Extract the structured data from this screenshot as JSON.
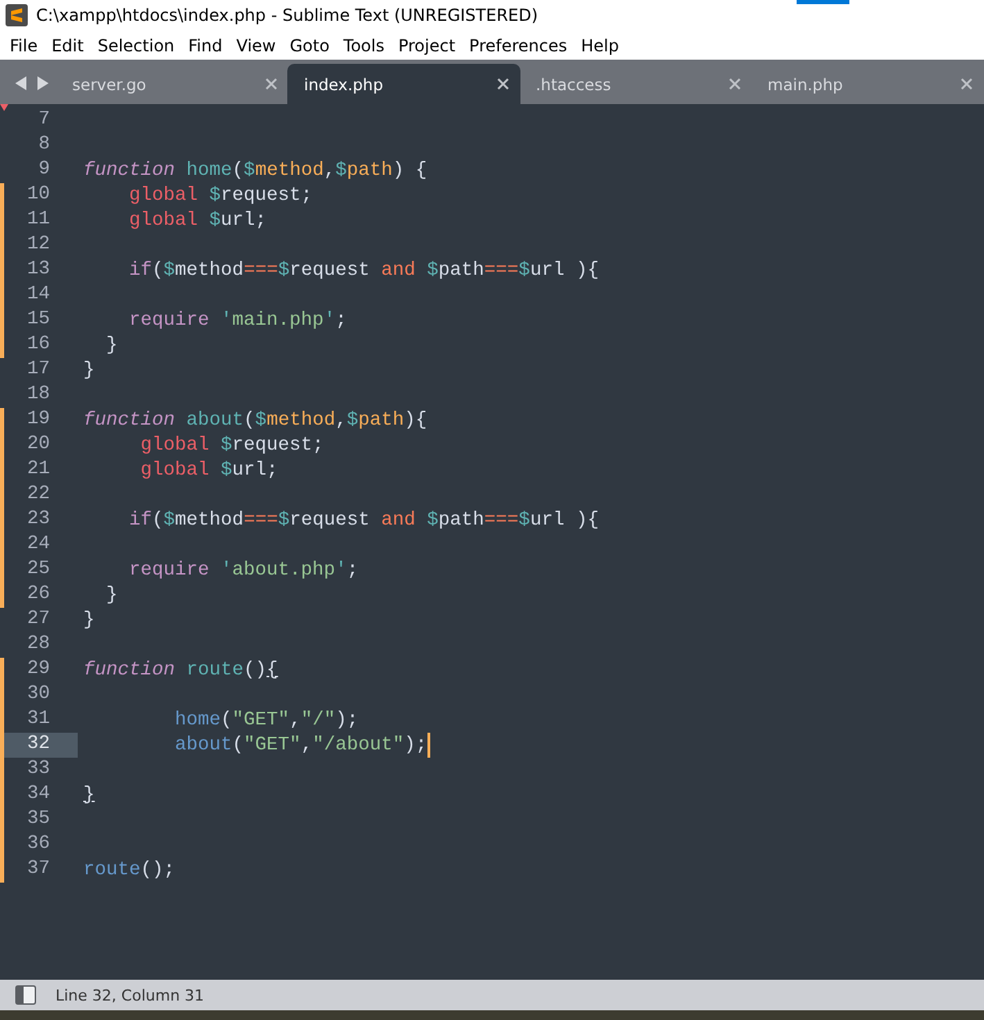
{
  "window": {
    "title": "C:\\xampp\\htdocs\\index.php - Sublime Text (UNREGISTERED)"
  },
  "menu": [
    {
      "label": "File"
    },
    {
      "label": "Edit"
    },
    {
      "label": "Selection"
    },
    {
      "label": "Find"
    },
    {
      "label": "View"
    },
    {
      "label": "Goto"
    },
    {
      "label": "Tools"
    },
    {
      "label": "Project"
    },
    {
      "label": "Preferences"
    },
    {
      "label": "Help"
    }
  ],
  "tabs": [
    {
      "label": "server.go",
      "selected": false
    },
    {
      "label": "index.php",
      "selected": true
    },
    {
      "label": ".htaccess",
      "selected": false
    },
    {
      "label": "main.php",
      "selected": false
    }
  ],
  "lines": [
    {
      "number": "7",
      "modified": false,
      "current": false
    },
    {
      "number": "8",
      "modified": false,
      "current": false
    },
    {
      "number": "9",
      "modified": false,
      "current": false,
      "tokens": [
        {
          "t": "function ",
          "kind": "kw"
        },
        {
          "t": "home",
          "kind": "fn"
        },
        {
          "t": "(",
          "kind": "plain"
        },
        {
          "t": "$",
          "kind": "dollar"
        },
        {
          "t": "method",
          "kind": "param"
        },
        {
          "t": ",",
          "kind": "plain"
        },
        {
          "t": "$",
          "kind": "dollar"
        },
        {
          "t": "path",
          "kind": "param"
        },
        {
          "t": ") {",
          "kind": "plain"
        }
      ]
    },
    {
      "number": "10",
      "modified": true,
      "current": false,
      "tokens": [
        {
          "t": "    global ",
          "kind": "global"
        },
        {
          "t": "$",
          "kind": "dollar"
        },
        {
          "t": "request;",
          "kind": "plain"
        }
      ]
    },
    {
      "number": "11",
      "modified": true,
      "current": false,
      "tokens": [
        {
          "t": "    global ",
          "kind": "global"
        },
        {
          "t": "$",
          "kind": "dollar"
        },
        {
          "t": "url;",
          "kind": "plain"
        }
      ]
    },
    {
      "number": "12",
      "modified": true,
      "current": false
    },
    {
      "number": "13",
      "modified": true,
      "current": false,
      "tokens": [
        {
          "t": "    if",
          "kind": "kw2"
        },
        {
          "t": "(",
          "kind": "plain"
        },
        {
          "t": "$",
          "kind": "dollar"
        },
        {
          "t": "method",
          "kind": "plain"
        },
        {
          "t": "===",
          "kind": "op"
        },
        {
          "t": "$",
          "kind": "dollar"
        },
        {
          "t": "request ",
          "kind": "plain"
        },
        {
          "t": "and ",
          "kind": "op"
        },
        {
          "t": "$",
          "kind": "dollar"
        },
        {
          "t": "path",
          "kind": "plain"
        },
        {
          "t": "===",
          "kind": "op"
        },
        {
          "t": "$",
          "kind": "dollar"
        },
        {
          "t": "url ){",
          "kind": "plain"
        }
      ]
    },
    {
      "number": "14",
      "modified": true,
      "current": false
    },
    {
      "number": "15",
      "modified": true,
      "current": false,
      "tokens": [
        {
          "t": "    require ",
          "kind": "kw2"
        },
        {
          "t": "'",
          "kind": "quote"
        },
        {
          "t": "main.php",
          "kind": "str"
        },
        {
          "t": "'",
          "kind": "quote"
        },
        {
          "t": ";",
          "kind": "plain"
        }
      ]
    },
    {
      "number": "16",
      "modified": true,
      "current": false,
      "tokens": [
        {
          "t": "  }",
          "kind": "plain"
        }
      ]
    },
    {
      "number": "17",
      "modified": false,
      "current": false,
      "tokens": [
        {
          "t": "}",
          "kind": "plain"
        }
      ]
    },
    {
      "number": "18",
      "modified": false,
      "current": false
    },
    {
      "number": "19",
      "modified": true,
      "current": false,
      "tokens": [
        {
          "t": "function ",
          "kind": "kw"
        },
        {
          "t": "about",
          "kind": "fn"
        },
        {
          "t": "(",
          "kind": "plain"
        },
        {
          "t": "$",
          "kind": "dollar"
        },
        {
          "t": "method",
          "kind": "param"
        },
        {
          "t": ",",
          "kind": "plain"
        },
        {
          "t": "$",
          "kind": "dollar"
        },
        {
          "t": "path",
          "kind": "param"
        },
        {
          "t": "){",
          "kind": "plain"
        }
      ]
    },
    {
      "number": "20",
      "modified": true,
      "current": false,
      "tokens": [
        {
          "t": "     global ",
          "kind": "global"
        },
        {
          "t": "$",
          "kind": "dollar"
        },
        {
          "t": "request;",
          "kind": "plain"
        }
      ]
    },
    {
      "number": "21",
      "modified": true,
      "current": false,
      "tokens": [
        {
          "t": "     global ",
          "kind": "global"
        },
        {
          "t": "$",
          "kind": "dollar"
        },
        {
          "t": "url;",
          "kind": "plain"
        }
      ]
    },
    {
      "number": "22",
      "modified": true,
      "current": false
    },
    {
      "number": "23",
      "modified": true,
      "current": false,
      "tokens": [
        {
          "t": "    if",
          "kind": "kw2"
        },
        {
          "t": "(",
          "kind": "plain"
        },
        {
          "t": "$",
          "kind": "dollar"
        },
        {
          "t": "method",
          "kind": "plain"
        },
        {
          "t": "===",
          "kind": "op"
        },
        {
          "t": "$",
          "kind": "dollar"
        },
        {
          "t": "request ",
          "kind": "plain"
        },
        {
          "t": "and ",
          "kind": "op"
        },
        {
          "t": "$",
          "kind": "dollar"
        },
        {
          "t": "path",
          "kind": "plain"
        },
        {
          "t": "===",
          "kind": "op"
        },
        {
          "t": "$",
          "kind": "dollar"
        },
        {
          "t": "url ){",
          "kind": "plain"
        }
      ]
    },
    {
      "number": "24",
      "modified": true,
      "current": false
    },
    {
      "number": "25",
      "modified": true,
      "current": false,
      "tokens": [
        {
          "t": "    require ",
          "kind": "kw2"
        },
        {
          "t": "'",
          "kind": "quote"
        },
        {
          "t": "about.php",
          "kind": "str"
        },
        {
          "t": "'",
          "kind": "quote"
        },
        {
          "t": ";",
          "kind": "plain"
        }
      ]
    },
    {
      "number": "26",
      "modified": true,
      "current": false,
      "tokens": [
        {
          "t": "  }",
          "kind": "plain"
        }
      ]
    },
    {
      "number": "27",
      "modified": false,
      "current": false,
      "tokens": [
        {
          "t": "}",
          "kind": "plain"
        }
      ]
    },
    {
      "number": "28",
      "modified": false,
      "current": false
    },
    {
      "number": "29",
      "modified": true,
      "current": false,
      "tokens": [
        {
          "t": "function ",
          "kind": "kw"
        },
        {
          "t": "route",
          "kind": "fn"
        },
        {
          "t": "()",
          "kind": "plain"
        },
        {
          "t": "{",
          "kind": "match"
        }
      ]
    },
    {
      "number": "30",
      "modified": true,
      "current": false
    },
    {
      "number": "31",
      "modified": true,
      "current": false,
      "tokens": [
        {
          "t": "        home",
          "kind": "call"
        },
        {
          "t": "(",
          "kind": "plain"
        },
        {
          "t": "\"GET\"",
          "kind": "str"
        },
        {
          "t": ",",
          "kind": "plain"
        },
        {
          "t": "\"/\"",
          "kind": "str"
        },
        {
          "t": ");",
          "kind": "plain"
        }
      ]
    },
    {
      "number": "32",
      "modified": true,
      "current": true,
      "tokens": [
        {
          "t": "        about",
          "kind": "call"
        },
        {
          "t": "(",
          "kind": "plain"
        },
        {
          "t": "\"GET\"",
          "kind": "str"
        },
        {
          "t": ",",
          "kind": "plain"
        },
        {
          "t": "\"/about\"",
          "kind": "str"
        },
        {
          "t": ");",
          "kind": "plain"
        }
      ]
    },
    {
      "number": "33",
      "modified": true,
      "current": false
    },
    {
      "number": "34",
      "modified": true,
      "current": false,
      "tokens": [
        {
          "t": "}",
          "kind": "match"
        }
      ]
    },
    {
      "number": "35",
      "modified": true,
      "current": false
    },
    {
      "number": "36",
      "modified": true,
      "current": false
    },
    {
      "number": "37",
      "modified": true,
      "current": false,
      "tokens": [
        {
          "t": "route",
          "kind": "call"
        },
        {
          "t": "();",
          "kind": "plain"
        }
      ]
    }
  ],
  "status_bar": {
    "text": "Line 32, Column 31"
  }
}
